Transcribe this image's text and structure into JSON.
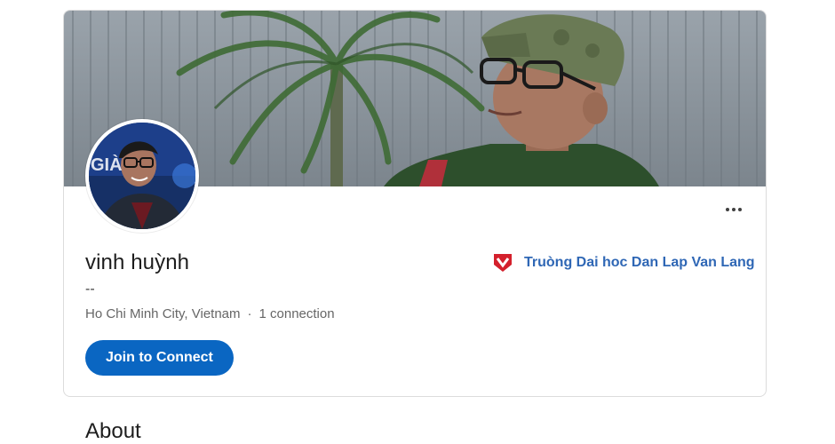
{
  "profile": {
    "name": "vinh huỳnh",
    "headline": "--",
    "location": "Ho Chi Minh City, Vietnam",
    "separator": "·",
    "connections": "1 connection",
    "join_button": "Join to Connect",
    "more_icon": "ellipsis-icon",
    "avatar_text": "GIÀ"
  },
  "education": {
    "school_name": "Truòng Dai hoc Dan Lap Van Lang",
    "logo_icon": "school-logo-icon"
  },
  "sections": {
    "about_title": "About"
  },
  "colors": {
    "accent": "#0a66c2",
    "school_link": "#2f67b5",
    "school_logo": "#d4202c"
  }
}
